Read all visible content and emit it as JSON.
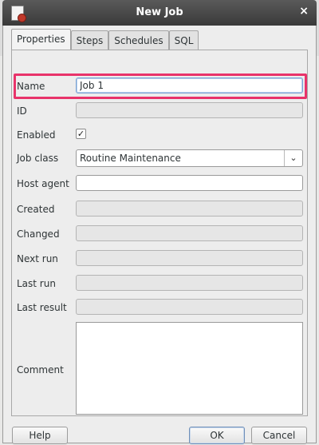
{
  "window": {
    "title": "New Job",
    "close_glyph": "×"
  },
  "tabs": [
    {
      "label": "Properties",
      "active": true
    },
    {
      "label": "Steps",
      "active": false
    },
    {
      "label": "Schedules",
      "active": false
    },
    {
      "label": "SQL",
      "active": false
    }
  ],
  "form": {
    "name": {
      "label": "Name",
      "value": "Job 1"
    },
    "id": {
      "label": "ID",
      "value": ""
    },
    "enabled": {
      "label": "Enabled",
      "checked": true,
      "check_glyph": "✓"
    },
    "job_class": {
      "label": "Job class",
      "value": "Routine Maintenance",
      "chevron_glyph": "⌄"
    },
    "host_agent": {
      "label": "Host agent",
      "value": ""
    },
    "created": {
      "label": "Created",
      "value": ""
    },
    "changed": {
      "label": "Changed",
      "value": ""
    },
    "next_run": {
      "label": "Next run",
      "value": ""
    },
    "last_run": {
      "label": "Last run",
      "value": ""
    },
    "last_result": {
      "label": "Last result",
      "value": ""
    },
    "comment": {
      "label": "Comment",
      "value": ""
    }
  },
  "buttons": {
    "help": "Help",
    "ok": "OK",
    "cancel": "Cancel"
  },
  "colors": {
    "highlight": "#e8336a",
    "titlebar": "#3a3a3a"
  }
}
